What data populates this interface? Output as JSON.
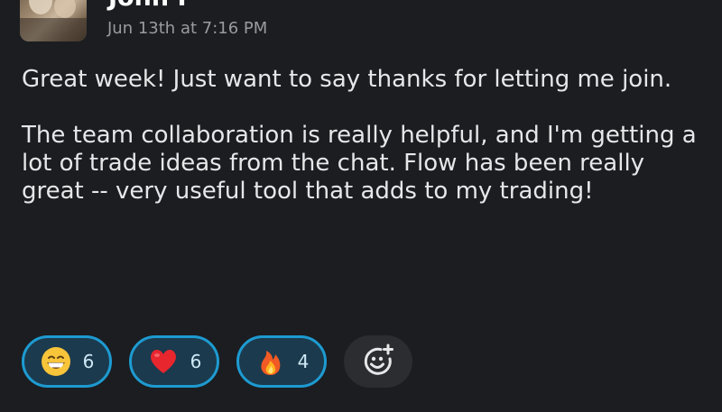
{
  "message": {
    "author": "John P",
    "timestamp": "Jun 13th at 7:16 PM",
    "paragraphs": [
      "Great week! Just want to say thanks for letting me join.",
      "The team collaboration is really helpful, and I'm getting a lot of trade ideas from the chat. Flow has been really great -- very useful tool that adds to my trading!"
    ]
  },
  "reactions": [
    {
      "icon": "grinning-face-emoji",
      "count": "6"
    },
    {
      "icon": "red-heart-emoji",
      "count": "6"
    },
    {
      "icon": "fire-emoji",
      "count": "4"
    }
  ],
  "add_reaction": {
    "icon": "add-reaction-icon"
  },
  "colors": {
    "background": "#1b1d21",
    "reaction_border": "#1d9bd1",
    "reaction_bg": "#1c3a4d",
    "timestamp": "#9a9b9e"
  }
}
